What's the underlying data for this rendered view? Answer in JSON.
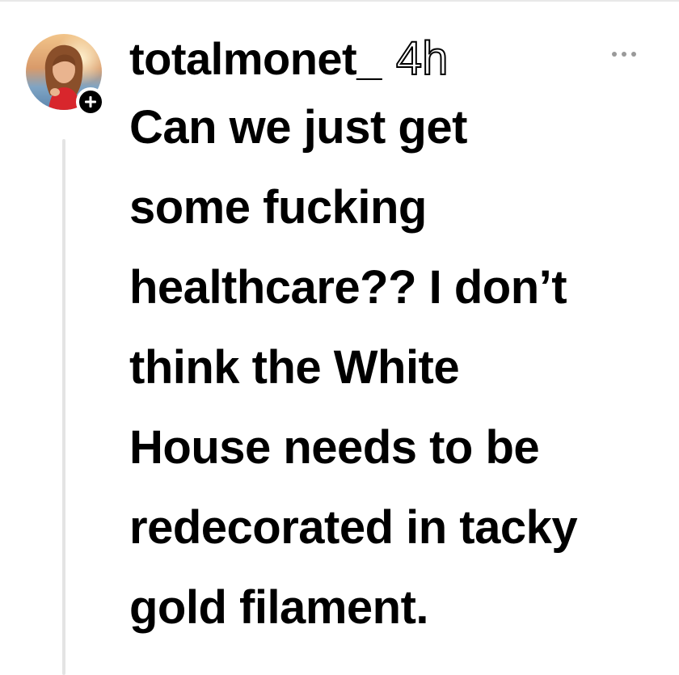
{
  "post": {
    "username": "totalmonet_",
    "timestamp": "4h",
    "text": "Can we just get\nsome fucking\nhealthcare?? I don’t\nthink the White\nHouse needs to be\nredecorated in tacky\ngold filament."
  },
  "icons": {
    "more": "more-horizontal-icon",
    "follow": "plus-icon",
    "avatar": "user-avatar"
  },
  "colors": {
    "background": "#ffffff",
    "text": "#000000",
    "thread_line": "#e4e4e4",
    "more_icon": "#9a9a9a"
  }
}
